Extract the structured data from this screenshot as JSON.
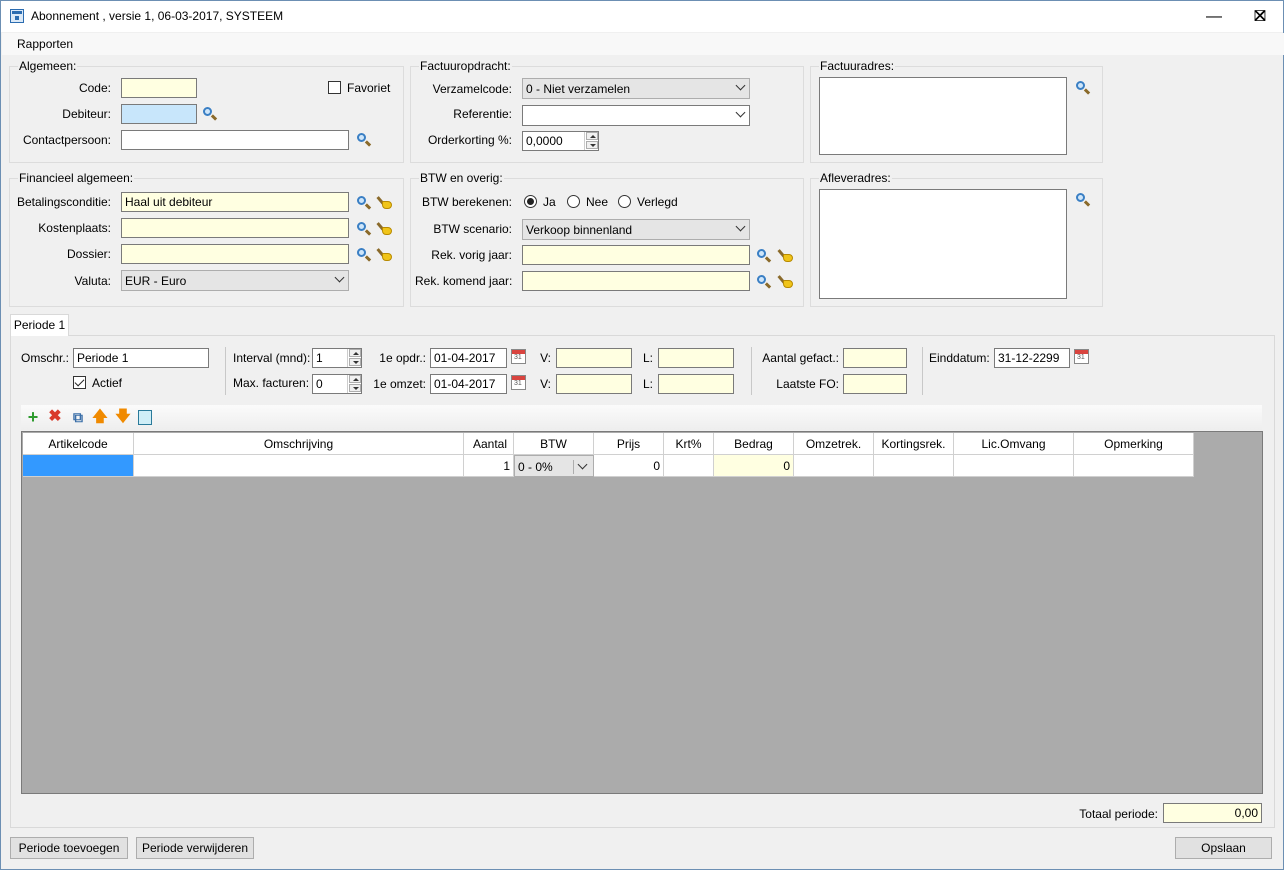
{
  "window": {
    "title": "Abonnement , versie 1, 06-03-2017, SYSTEEM"
  },
  "menu": {
    "items": [
      "Rapporten"
    ]
  },
  "algemeen": {
    "title": "Algemeen:",
    "code_label": "Code:",
    "code_value": "",
    "favoriet_label": "Favoriet",
    "favoriet_checked": false,
    "debiteur_label": "Debiteur:",
    "debiteur_value": "",
    "contactpersoon_label": "Contactpersoon:",
    "contactpersoon_value": ""
  },
  "factuuropdracht": {
    "title": "Factuuropdracht:",
    "verzamelcode_label": "Verzamelcode:",
    "verzamelcode_value": "0 - Niet verzamelen",
    "referentie_label": "Referentie:",
    "referentie_value": "",
    "orderkorting_label": "Orderkorting %:",
    "orderkorting_value": "0,0000"
  },
  "factuuradres": {
    "title": "Factuuradres:",
    "value": ""
  },
  "financieel": {
    "title": "Financieel algemeen:",
    "betalingsconditie_label": "Betalingsconditie:",
    "betalingsconditie_value": "Haal uit debiteur",
    "kostenplaats_label": "Kostenplaats:",
    "kostenplaats_value": "",
    "dossier_label": "Dossier:",
    "dossier_value": "",
    "valuta_label": "Valuta:",
    "valuta_value": "EUR - Euro"
  },
  "btw": {
    "title": "BTW en overig:",
    "berekenen_label": "BTW berekenen:",
    "options": [
      "Ja",
      "Nee",
      "Verlegd"
    ],
    "selected": "Ja",
    "scenario_label": "BTW scenario:",
    "scenario_value": "Verkoop binnenland",
    "vorig_label": "Rek. vorig jaar:",
    "vorig_value": "",
    "komend_label": "Rek. komend jaar:",
    "komend_value": ""
  },
  "afleveradres": {
    "title": "Afleveradres:",
    "value": ""
  },
  "periode": {
    "tab_label": "Periode 1",
    "omschr_label": "Omschr.:",
    "omschr_value": "Periode 1",
    "actief_label": "Actief",
    "actief_checked": true,
    "interval_label": "Interval (mnd):",
    "interval_value": "1",
    "max_label": "Max. facturen:",
    "max_value": "0",
    "opdr_label": "1e opdr.:",
    "opdr_value": "01-04-2017",
    "omzet_label": "1e omzet:",
    "omzet_value": "01-04-2017",
    "v_label": "V:",
    "l_label": "L:",
    "aantal_gefact_label": "Aantal gefact.:",
    "aantal_gefact_value": "",
    "laatste_fo_label": "Laatste FO:",
    "laatste_fo_value": "",
    "einddatum_label": "Einddatum:",
    "einddatum_value": "31-12-2299",
    "cal_day": "31"
  },
  "toolbar_icons": [
    "add-icon",
    "delete-icon",
    "copy-icon",
    "move-up-icon",
    "move-down-icon",
    "calculator-icon"
  ],
  "grid": {
    "headers": [
      "Artikelcode",
      "Omschrijving",
      "Aantal",
      "BTW",
      "Prijs",
      "Krt%",
      "Bedrag",
      "Omzetrek.",
      "Kortingsrek.",
      "Lic.Omvang",
      "Opmerking"
    ],
    "rows": [
      {
        "artikelcode": "",
        "omschrijving": "",
        "aantal": "1",
        "btw": "0 - 0%",
        "prijs": "0",
        "krt": "",
        "bedrag": "0",
        "omzetrek": "",
        "kortingsrek": "",
        "licomvang": "",
        "opmerking": ""
      }
    ]
  },
  "totaal": {
    "label": "Totaal periode:",
    "value": "0,00"
  },
  "buttons": {
    "periode_toevoegen": "Periode toevoegen",
    "periode_verwijderen": "Periode verwijderen",
    "opslaan": "Opslaan"
  },
  "colors": {
    "yellow_field": "#ffffe1",
    "blue_field": "#c8e6fb",
    "grid_bg": "#ababab",
    "selected_cell": "#3399ff"
  }
}
